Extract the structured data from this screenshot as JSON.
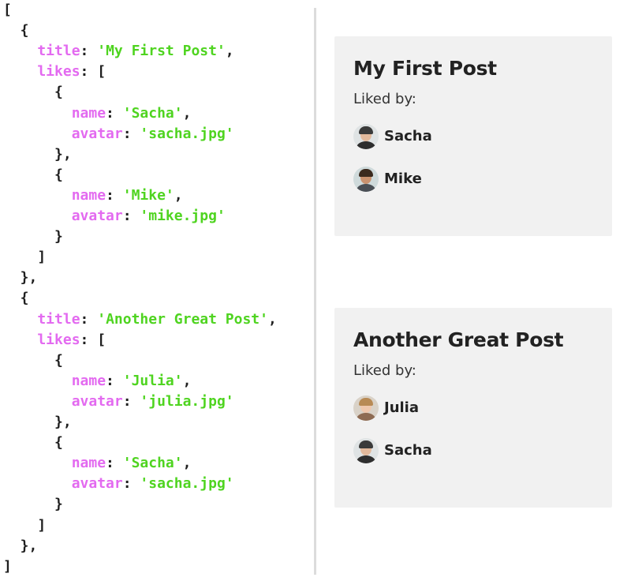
{
  "code": {
    "lines": [
      [
        {
          "t": "[",
          "c": "p"
        }
      ],
      [
        {
          "t": "  {",
          "c": "p"
        }
      ],
      [
        {
          "t": "    title",
          "c": "k"
        },
        {
          "t": ": ",
          "c": "p"
        },
        {
          "t": "'My First Post'",
          "c": "s"
        },
        {
          "t": ",",
          "c": "p"
        }
      ],
      [
        {
          "t": "    likes",
          "c": "k"
        },
        {
          "t": ": [",
          "c": "p"
        }
      ],
      [
        {
          "t": "      {",
          "c": "p"
        }
      ],
      [
        {
          "t": "        name",
          "c": "k"
        },
        {
          "t": ": ",
          "c": "p"
        },
        {
          "t": "'Sacha'",
          "c": "s"
        },
        {
          "t": ",",
          "c": "p"
        }
      ],
      [
        {
          "t": "        avatar",
          "c": "k"
        },
        {
          "t": ": ",
          "c": "p"
        },
        {
          "t": "'sacha.jpg'",
          "c": "s"
        }
      ],
      [
        {
          "t": "      },",
          "c": "p"
        }
      ],
      [
        {
          "t": "      {",
          "c": "p"
        }
      ],
      [
        {
          "t": "        name",
          "c": "k"
        },
        {
          "t": ": ",
          "c": "p"
        },
        {
          "t": "'Mike'",
          "c": "s"
        },
        {
          "t": ",",
          "c": "p"
        }
      ],
      [
        {
          "t": "        avatar",
          "c": "k"
        },
        {
          "t": ": ",
          "c": "p"
        },
        {
          "t": "'mike.jpg'",
          "c": "s"
        }
      ],
      [
        {
          "t": "      }",
          "c": "p"
        }
      ],
      [
        {
          "t": "    ]",
          "c": "p"
        }
      ],
      [
        {
          "t": "  },",
          "c": "p"
        }
      ],
      [
        {
          "t": "  {",
          "c": "p"
        }
      ],
      [
        {
          "t": "    title",
          "c": "k"
        },
        {
          "t": ": ",
          "c": "p"
        },
        {
          "t": "'Another Great Post'",
          "c": "s"
        },
        {
          "t": ",",
          "c": "p"
        }
      ],
      [
        {
          "t": "    likes",
          "c": "k"
        },
        {
          "t": ": [",
          "c": "p"
        }
      ],
      [
        {
          "t": "      {",
          "c": "p"
        }
      ],
      [
        {
          "t": "        name",
          "c": "k"
        },
        {
          "t": ": ",
          "c": "p"
        },
        {
          "t": "'Julia'",
          "c": "s"
        },
        {
          "t": ",",
          "c": "p"
        }
      ],
      [
        {
          "t": "        avatar",
          "c": "k"
        },
        {
          "t": ": ",
          "c": "p"
        },
        {
          "t": "'julia.jpg'",
          "c": "s"
        }
      ],
      [
        {
          "t": "      },",
          "c": "p"
        }
      ],
      [
        {
          "t": "      {",
          "c": "p"
        }
      ],
      [
        {
          "t": "        name",
          "c": "k"
        },
        {
          "t": ": ",
          "c": "p"
        },
        {
          "t": "'Sacha'",
          "c": "s"
        },
        {
          "t": ",",
          "c": "p"
        }
      ],
      [
        {
          "t": "        avatar",
          "c": "k"
        },
        {
          "t": ": ",
          "c": "p"
        },
        {
          "t": "'sacha.jpg'",
          "c": "s"
        }
      ],
      [
        {
          "t": "      }",
          "c": "p"
        }
      ],
      [
        {
          "t": "    ]",
          "c": "p"
        }
      ],
      [
        {
          "t": "  },",
          "c": "p"
        }
      ],
      [
        {
          "t": "]",
          "c": "p"
        }
      ]
    ],
    "colors": {
      "key": "#e36af0",
      "string": "#4fd420",
      "punct": "#1f1f1f"
    }
  },
  "posts": [
    {
      "title": "My First Post",
      "liked_by_label": "Liked by:",
      "likes": [
        {
          "name": "Sacha",
          "avatar_icon": "sacha-avatar-icon"
        },
        {
          "name": "Mike",
          "avatar_icon": "mike-avatar-icon"
        }
      ]
    },
    {
      "title": "Another Great Post",
      "liked_by_label": "Liked by:",
      "likes": [
        {
          "name": "Julia",
          "avatar_icon": "julia-avatar-icon"
        },
        {
          "name": "Sacha",
          "avatar_icon": "sacha-avatar-icon"
        }
      ]
    }
  ],
  "avatar_styles": {
    "Sacha": {
      "bg": "#dfe3e4",
      "skin": "#e2b99c",
      "hair": "#3a3a3a",
      "shirt": "#2e2e2e"
    },
    "Mike": {
      "bg": "#cfdadb",
      "skin": "#c9926f",
      "hair": "#3b2a1e",
      "shirt": "#4a4f55"
    },
    "Julia": {
      "bg": "#d9d2c8",
      "skin": "#efc7ad",
      "hair": "#b88a55",
      "shirt": "#8e6b53"
    }
  }
}
